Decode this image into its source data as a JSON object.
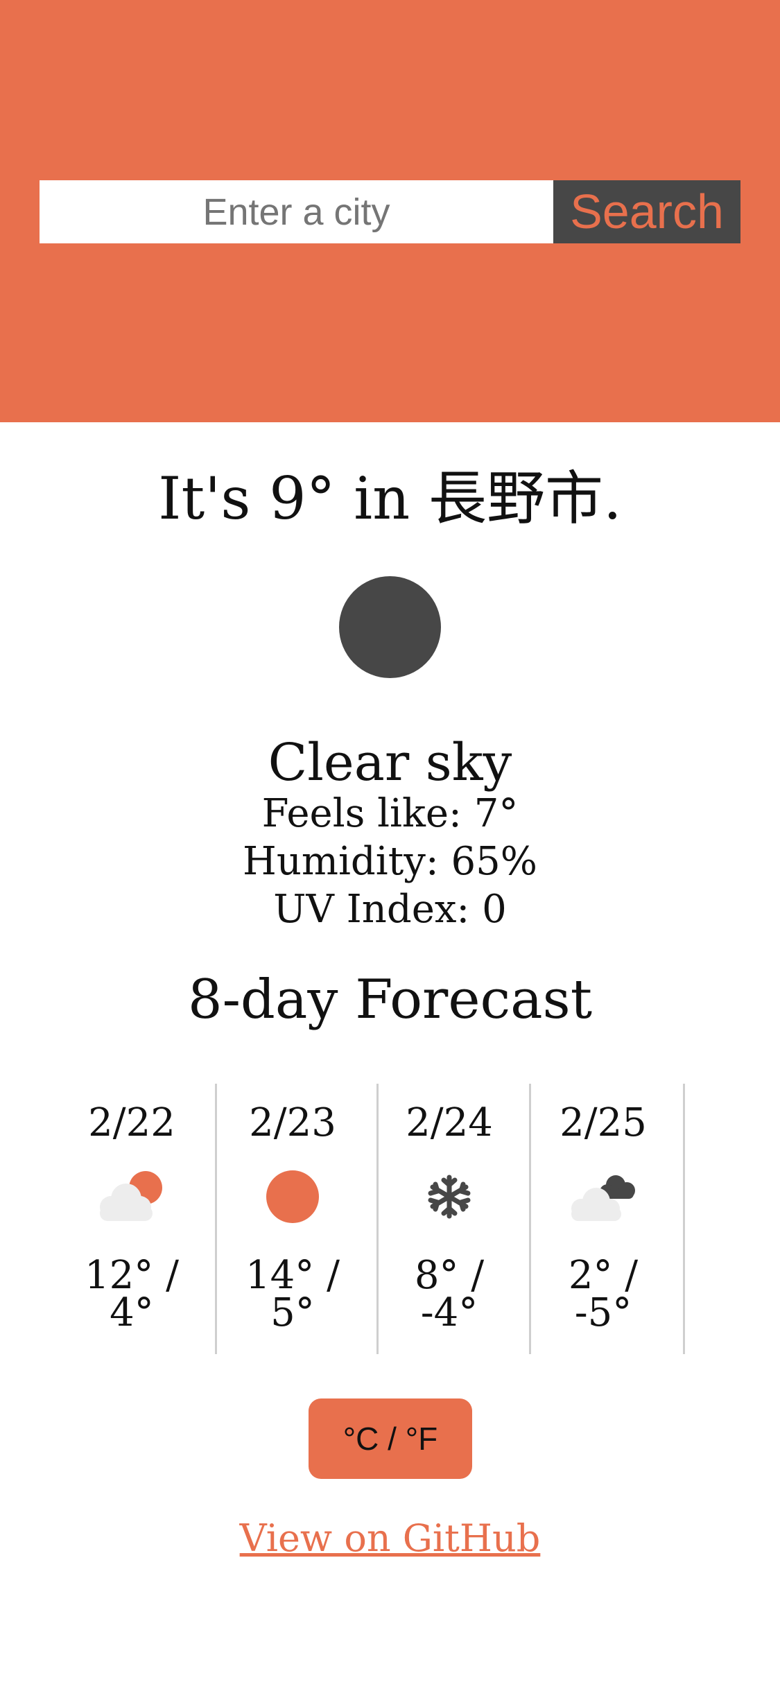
{
  "search": {
    "placeholder": "Enter a city",
    "button_label": "Search"
  },
  "current": {
    "headline_prefix": "It's ",
    "temperature": "9°",
    "headline_middle": " in ",
    "city": "長野市",
    "headline_suffix": ".",
    "icon": "clear-sky-icon",
    "condition": "Clear sky",
    "feels_like_label": "Feels like: ",
    "feels_like": "7°",
    "humidity_label": "Humidity: ",
    "humidity": "65%",
    "uv_label": "UV Index: ",
    "uv_index": "0"
  },
  "forecast": {
    "title": "8-day Forecast",
    "days": [
      {
        "date": "2/22",
        "icon": "partly-cloudy-icon",
        "high": "12° /",
        "low": "4°"
      },
      {
        "date": "2/23",
        "icon": "sun-icon",
        "high": "14° /",
        "low": "5°"
      },
      {
        "date": "2/24",
        "icon": "snowflake-icon",
        "high": "8° /",
        "low": "-4°"
      },
      {
        "date": "2/25",
        "icon": "cloudy-icon",
        "high": "2° /",
        "low": "-5°"
      }
    ]
  },
  "unit_toggle": {
    "label": "°C / °F"
  },
  "footer": {
    "github_link": "View on GitHub"
  },
  "colors": {
    "accent": "#E8704D",
    "dark": "#474747",
    "cloud": "#EDEDED",
    "divider": "#CFCFCF",
    "background": "#FFFFFF"
  }
}
